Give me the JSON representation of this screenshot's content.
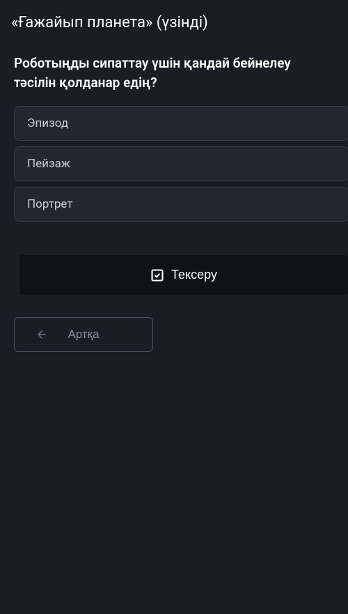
{
  "header": {
    "title": "«Ғажайып планета» (үзінді)"
  },
  "question": {
    "text": "Роботыңды сипаттау үшін қандай бейнелеу тәсілін қолданар едің?"
  },
  "options": [
    {
      "label": "Эпизод"
    },
    {
      "label": "Пейзаж"
    },
    {
      "label": "Портрет"
    }
  ],
  "buttons": {
    "check_label": "Тексеру",
    "back_label": "Артқа"
  }
}
